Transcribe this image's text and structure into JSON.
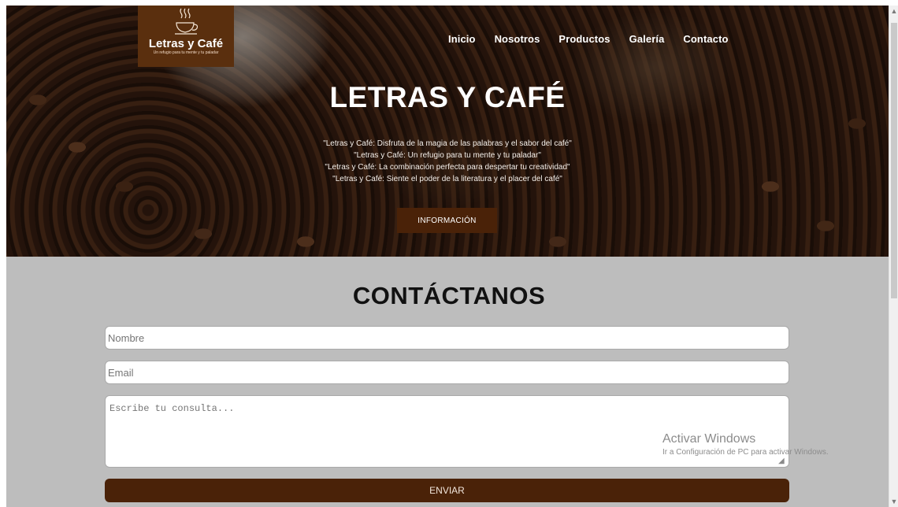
{
  "header": {
    "logo": {
      "brand": "Letras y Café",
      "tagline": "Un refugio para tu mente y tu paladar",
      "icon": "coffee-cup-icon"
    },
    "nav": [
      "Inicio",
      "Nosotros",
      "Productos",
      "Galería",
      "Contacto"
    ]
  },
  "hero": {
    "title": "LETRAS Y CAFÉ",
    "lines": [
      "\"Letras y Café: Disfruta de la magia de las palabras y el sabor del café\"",
      "\"Letras y Café: Un refugio para tu mente y tu paladar\"",
      "\"Letras y Café: La combinación perfecta para despertar tu creatividad\"",
      "\"Letras y Café: Siente el poder de la literatura y el placer del café\""
    ],
    "button_label": "INFORMACIÓN"
  },
  "contact": {
    "title": "CONTÁCTANOS",
    "name_placeholder": "Nombre",
    "email_placeholder": "Email",
    "message_placeholder": "Escribe tu consulta...",
    "submit_label": "ENVIAR"
  },
  "watermark": {
    "line1": "Activar Windows",
    "line2": "Ir a Configuración de PC para activar Windows."
  },
  "colors": {
    "brand_brown": "#4a2208",
    "logo_bg": "#5a2f0e",
    "page_bg": "#bdbdbd"
  }
}
